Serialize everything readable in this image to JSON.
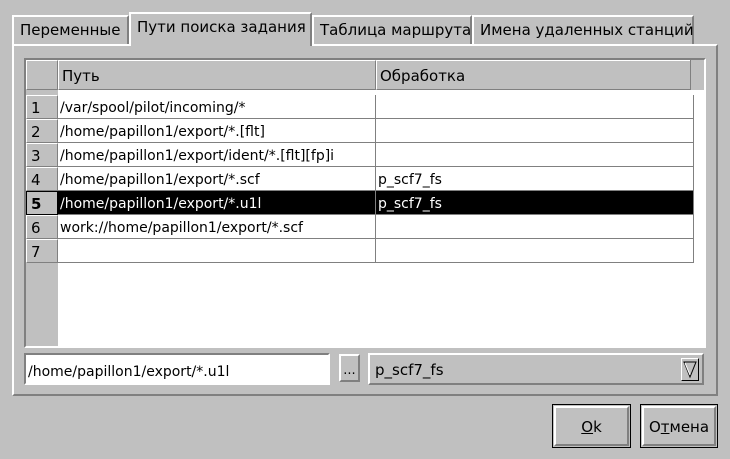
{
  "tabs": [
    {
      "label": "Переменные",
      "active": false
    },
    {
      "label": "Пути поиска задания",
      "active": true
    },
    {
      "label": "Таблица маршрута",
      "active": false
    },
    {
      "label": "Имена удаленных станций",
      "active": false
    }
  ],
  "table": {
    "columns": [
      "Путь",
      "Обработка"
    ],
    "rows": [
      {
        "num": "1",
        "path": "/var/spool/pilot/incoming/*",
        "handler": ""
      },
      {
        "num": "2",
        "path": "/home/papillon1/export/*.[flt]",
        "handler": ""
      },
      {
        "num": "3",
        "path": "/home/papillon1/export/ident/*.[flt][fp]i",
        "handler": ""
      },
      {
        "num": "4",
        "path": "/home/papillon1/export/*.scf",
        "handler": "p_scf7_fs"
      },
      {
        "num": "5",
        "path": "/home/papillon1/export/*.u1l",
        "handler": "p_scf7_fs"
      },
      {
        "num": "6",
        "path": "work://home/papillon1/export/*.scf",
        "handler": ""
      },
      {
        "num": "7",
        "path": "",
        "handler": ""
      }
    ],
    "selected_row": "5"
  },
  "editor": {
    "path_value": "/home/papillon1/export/*.u1l",
    "browse_label": "...",
    "handler_value": "p_scf7_fs"
  },
  "buttons": {
    "ok_mnemonic": "O",
    "ok_rest": "k",
    "cancel_pre": "О",
    "cancel_mnemonic": "т",
    "cancel_rest": "мена"
  },
  "colors": {
    "background": "#c0c0c0",
    "selection": "#000000",
    "selection_text": "#ffffff"
  }
}
